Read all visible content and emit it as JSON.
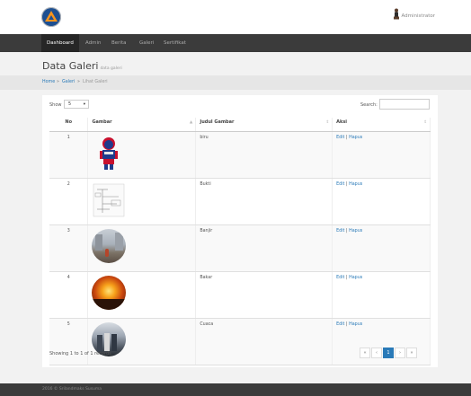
{
  "user": {
    "name": "Administrator"
  },
  "nav": {
    "items": [
      {
        "label": "Dashboard",
        "active": true
      },
      {
        "label": "Admin",
        "active": false
      },
      {
        "label": "Berita",
        "active": false
      },
      {
        "label": "Galeri",
        "active": false
      },
      {
        "label": "Sertifikat",
        "active": false
      }
    ]
  },
  "page": {
    "title": "Data Galeri",
    "subtitle": "data galeri"
  },
  "breadcrumb": {
    "home": "Home",
    "galeri": "Galeri",
    "current": "Lihat Galeri",
    "sep": "»"
  },
  "table": {
    "show_label": "Show",
    "show_value": "5",
    "search_label": "Search:",
    "search_value": "",
    "headers": [
      "No",
      "Gambar",
      "Judul Gambar",
      "Aksi"
    ],
    "rows": [
      {
        "no": "1",
        "title": "biru",
        "image": "hero-figure"
      },
      {
        "no": "2",
        "title": "Bukti",
        "image": "document"
      },
      {
        "no": "3",
        "title": "Banjir",
        "image": "flood"
      },
      {
        "no": "4",
        "title": "Bakar",
        "image": "fire"
      },
      {
        "no": "5",
        "title": "Cuaca",
        "image": "weather"
      }
    ],
    "edit_label": "Edit",
    "separator": "|",
    "delete_label": "Hapus",
    "showing_text": "Showing 1 to 1 of 1 records"
  },
  "pagination": {
    "first": "«",
    "prev": "‹",
    "current": "1",
    "next": "›",
    "last": "»"
  },
  "footer": {
    "text": "2016 © Srilandmaks Susuma"
  },
  "colors": {
    "nav_bg": "#3b3b3b",
    "link": "#2a7ab8",
    "active_page": "#2a7ab8"
  }
}
